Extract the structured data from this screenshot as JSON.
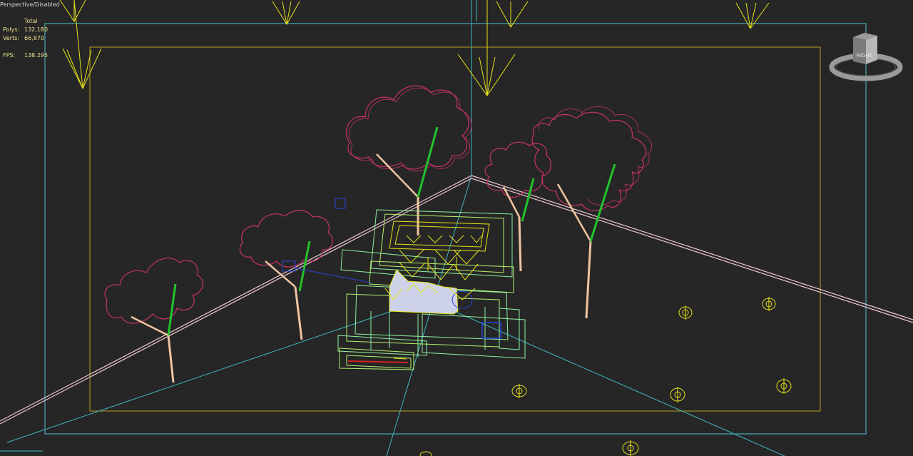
{
  "viewport": {
    "label": "Perspective/Disabled",
    "stats": {
      "header": "Total",
      "polys_label": "Polys:",
      "polys_value": "132,180",
      "verts_label": "Verts:",
      "verts_value": "66,870",
      "fps_label": "FPS:",
      "fps_value": "138.295"
    },
    "viewcube_face": "RIGHT"
  },
  "colors": {
    "background": "#262626",
    "safe_frame_outer": "#4fc3d0",
    "safe_frame_inner": "#b8a020",
    "lights": "#e6e21a",
    "tree_canopy": "#c8326a",
    "tree_trunk": "#f0c4a0",
    "tree_branch_green": "#22c32a",
    "building": "#b4f06c",
    "ground_plane": "#f2c8d2",
    "camera_lines": "#3fb6c4"
  }
}
